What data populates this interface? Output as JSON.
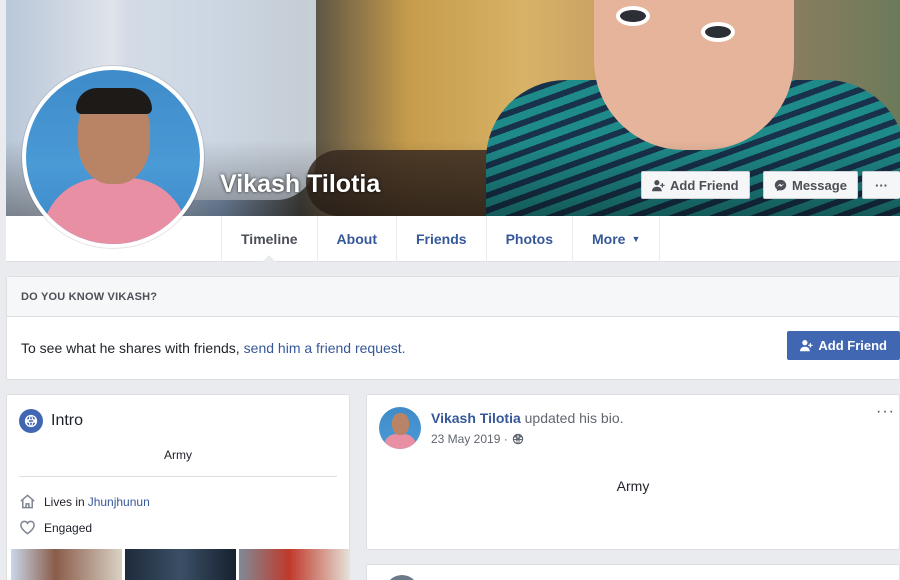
{
  "profile": {
    "name": "Vikash Tilotia",
    "add_friend_label": "Add Friend",
    "message_label": "Message",
    "more_label": "···"
  },
  "tabs": [
    {
      "label": "Timeline",
      "active": true
    },
    {
      "label": "About"
    },
    {
      "label": "Friends"
    },
    {
      "label": "Photos"
    },
    {
      "label": "More",
      "caret": "▼"
    }
  ],
  "know": {
    "header": "DO YOU KNOW VIKASH?",
    "text": "To see what he shares with friends,",
    "link": "send him a friend request.",
    "button_label": "Add Friend"
  },
  "intro": {
    "title": "Intro",
    "bio": "Army",
    "lives_in_label": "Lives in",
    "lives_in_value": "Jhunjhunun",
    "relationship": "Engaged"
  },
  "post": {
    "author": "Vikash Tilotia",
    "action": "updated his bio.",
    "date": "23 May 2019 ·",
    "more": "···",
    "text": "Army"
  },
  "colors": {
    "link_blue": "#365899",
    "button_blue": "#4267b2",
    "background": "#e9ebee"
  },
  "icons": [
    "add-friend-icon",
    "messenger-icon",
    "globe-icon",
    "home-icon",
    "heart-icon",
    "public-icon"
  ]
}
